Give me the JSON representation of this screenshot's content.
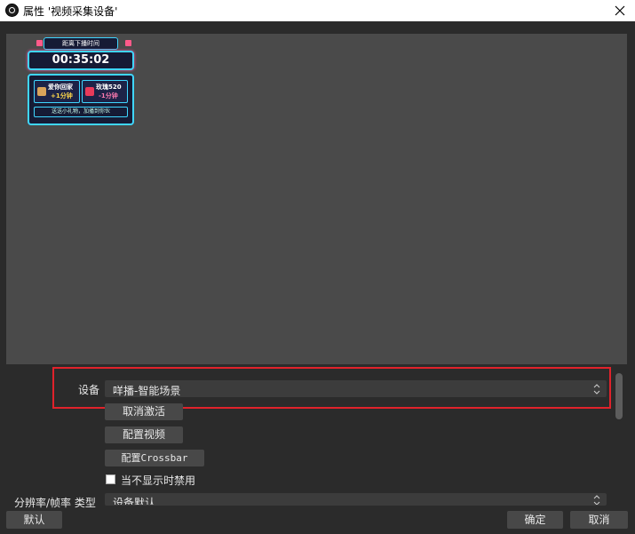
{
  "window": {
    "title": "属性 '视频采集设备'"
  },
  "widget": {
    "ribbon_text": "距离下播时间",
    "timer": "00:35:02",
    "cards": [
      {
        "title": "爱你回家",
        "delta": "+1分钟"
      },
      {
        "title": "玫瑰520",
        "delta": "-1分钟"
      }
    ],
    "note": "送送小礼物，加播到你伙"
  },
  "properties": {
    "device_label": "设备",
    "device_value": "咩播-智能场景",
    "deactivate_button": "取消激活",
    "configure_video_button": "配置视频",
    "configure_crossbar_button": "配置Crossbar",
    "disable_when_hidden_label": "当不显示时禁用",
    "disable_when_hidden_checked": false,
    "res_fps_label": "分辨率/帧率 类型",
    "res_fps_value": "设备默认"
  },
  "footer": {
    "defaults_button": "默认",
    "ok_button": "确定",
    "cancel_button": "取消"
  },
  "colors": {
    "highlight": "#e0222b",
    "widget_border": "#3fd6ff",
    "accent_gold": "#ffd84a"
  }
}
